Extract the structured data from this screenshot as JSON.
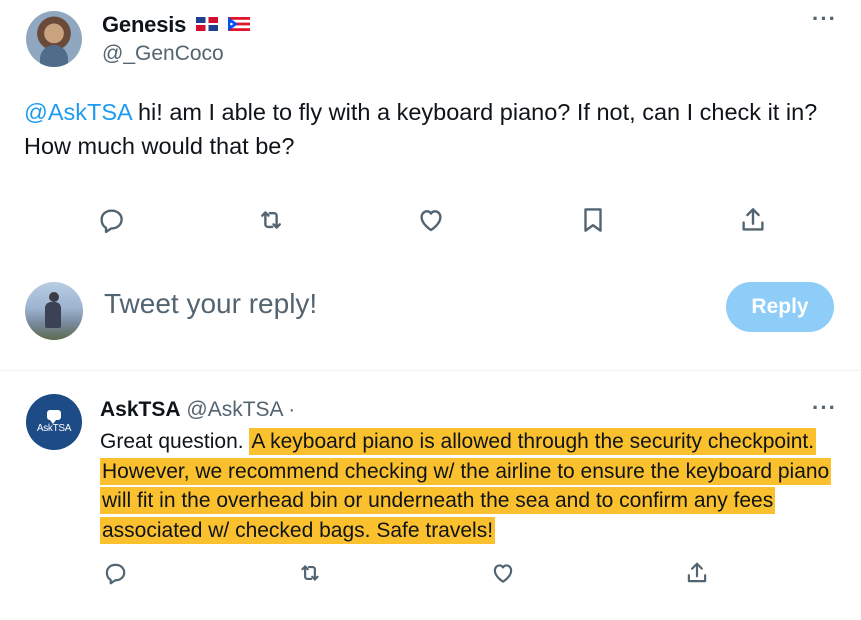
{
  "original_tweet": {
    "author_name": "Genesis",
    "author_handle": "@_GenCoco",
    "mention": "@AskTSA",
    "text": " hi! am I able to fly with a keyboard piano? If not, can I check it in? How much would that be?",
    "more_label": "···"
  },
  "composer": {
    "placeholder": "Tweet your reply!",
    "reply_label": "Reply"
  },
  "reply_tweet": {
    "avatar_text": "AskTSA",
    "author_name": "AskTSA",
    "author_handle": "@AskTSA",
    "separator": "·",
    "more_label": "···",
    "text_plain": "Great question. ",
    "text_highlighted": "A keyboard piano is allowed through the security checkpoint. However, we recommend checking w/ the airline to ensure the keyboard piano will fit in the overhead bin or underneath the sea and to confirm any fees associated w/ checked bags. Safe travels!"
  },
  "colors": {
    "accent": "#1d9bf0",
    "reply_button_disabled": "#8ecdf8",
    "highlight": "#fbc02d",
    "secondary_text": "#536471",
    "icon": "#536471"
  },
  "icons": [
    "comment-icon",
    "retweet-icon",
    "like-icon",
    "bookmark-icon",
    "share-icon",
    "more-icon"
  ]
}
